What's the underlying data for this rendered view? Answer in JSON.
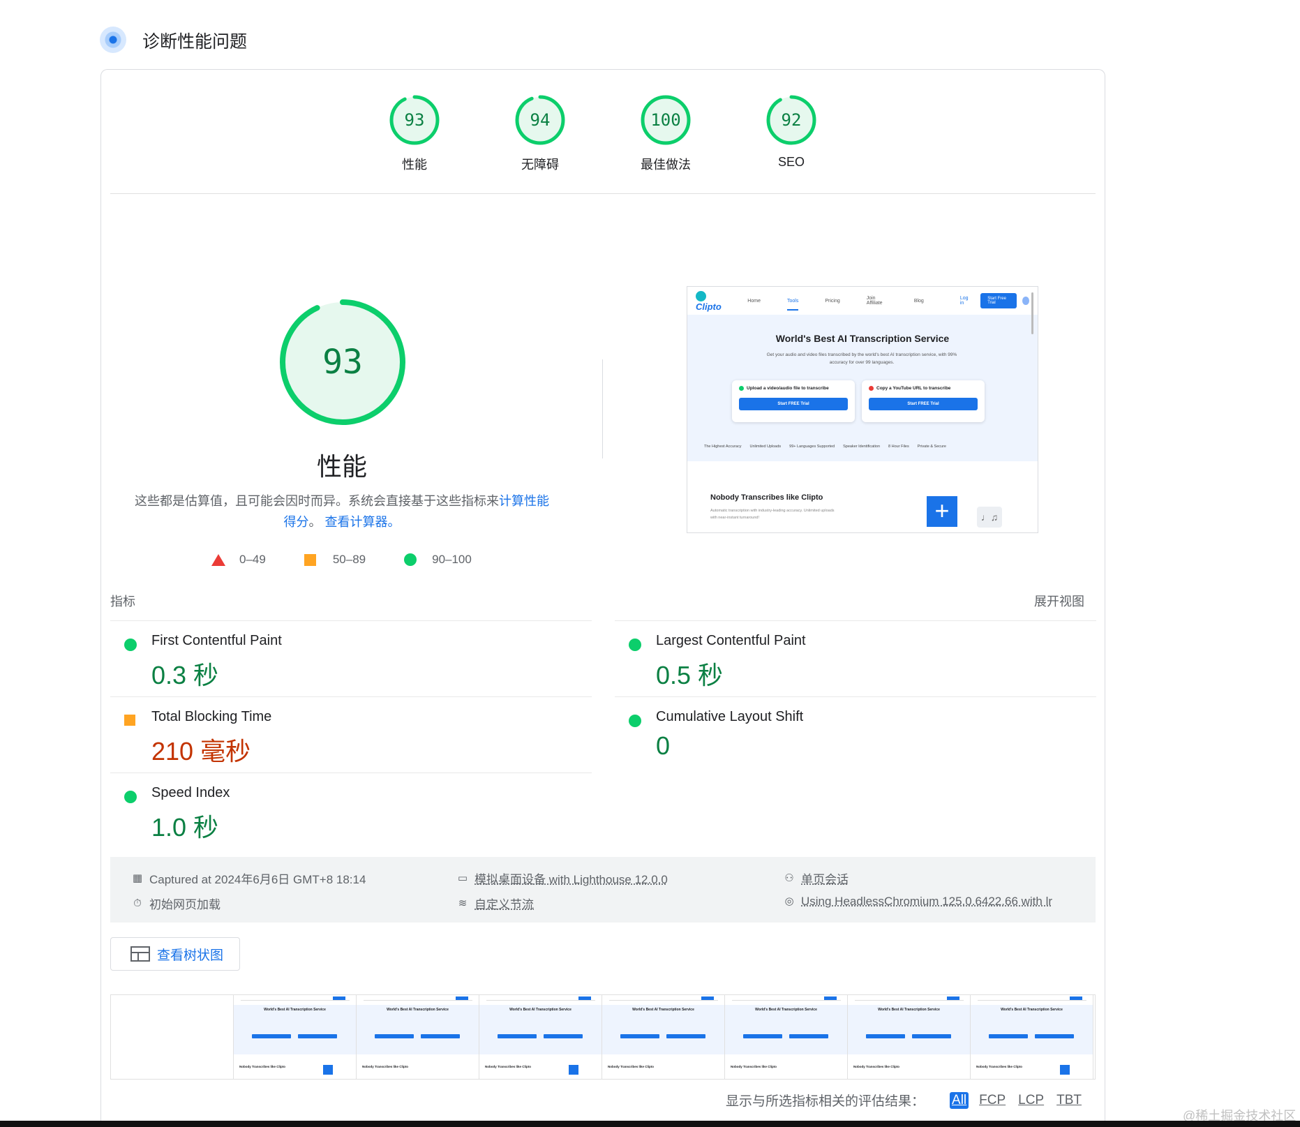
{
  "header": {
    "title": "诊断性能问题",
    "icon": "lighthouse-icon"
  },
  "scores": [
    {
      "value": "93",
      "label": "性能"
    },
    {
      "value": "94",
      "label": "无障碍"
    },
    {
      "value": "100",
      "label": "最佳做法"
    },
    {
      "value": "92",
      "label": "SEO"
    }
  ],
  "performance": {
    "score": "93",
    "title": "性能",
    "desc_text": "这些都是估算值，且可能会因时而异。系统会直接基于这些指标来",
    "desc_link1": "计算性能得分",
    "desc_sep": "。",
    "desc_link2": "查看计算器。",
    "legend": {
      "fail": "0–49",
      "average": "50–89",
      "pass": "90–100"
    }
  },
  "colors": {
    "pass": "#0cce6b",
    "average": "#ffa422",
    "fail": "#eb3b36",
    "link": "#1a73e8"
  },
  "screenshot": {
    "logo": "Clipto",
    "nav": [
      "Home",
      "Tools",
      "Pricing",
      "Join Affiliate",
      "Blog"
    ],
    "login": "Log in",
    "trial": "Start Free Trial",
    "headline": "World's Best AI Transcription Service",
    "sub": "Get your audio and video files transcribed by the world's best AI transcription service, with 99% accuracy for over 99 languages.",
    "card1": "Upload a video/audio file to transcribe",
    "card2": "Copy a YouTube URL to transcribe",
    "card_button": "Start FREE Trial",
    "features": [
      "The Highest Accuracy",
      "Unlimited Uploads",
      "99+ Languages Supported",
      "Speaker Identification",
      "8 Hour Files",
      "Private & Secure"
    ],
    "section_title": "Nobody Transcribes like Clipto",
    "section_text": "Automatic transcription with industry-leading accuracy. Unlimited uploads with near-instant turnaround!"
  },
  "metrics": {
    "label": "指标",
    "expand": "展开视图",
    "items": [
      {
        "name": "First Contentful Paint",
        "value": "0.3 秒",
        "status": "pass"
      },
      {
        "name": "Largest Contentful Paint",
        "value": "0.5 秒",
        "status": "pass"
      },
      {
        "name": "Total Blocking Time",
        "value": "210 毫秒",
        "status": "average"
      },
      {
        "name": "Cumulative Layout Shift",
        "value": "0",
        "status": "pass"
      },
      {
        "name": "Speed Index",
        "value": "1.0 秒",
        "status": "pass"
      }
    ]
  },
  "env": {
    "captured": "Captured at 2024年6月6日 GMT+8 18:14",
    "device": "模拟桌面设备 with Lighthouse 12.0.0",
    "session": "单页会话",
    "load": "初始网页加载",
    "throttle": "自定义节流",
    "browser": "Using HeadlessChromium 125.0.6422.66 with lr"
  },
  "tree_button": "查看树状图",
  "filmstrip": {
    "frame_title": "World's Best AI Transcription Service",
    "frame_section": "Nobody Transcribes like Clipto"
  },
  "filter": {
    "label": "显示与所选指标相关的评估结果：",
    "chips": [
      "All",
      "FCP",
      "LCP",
      "TBT"
    ]
  },
  "watermark": "@稀土掘金技术社区"
}
